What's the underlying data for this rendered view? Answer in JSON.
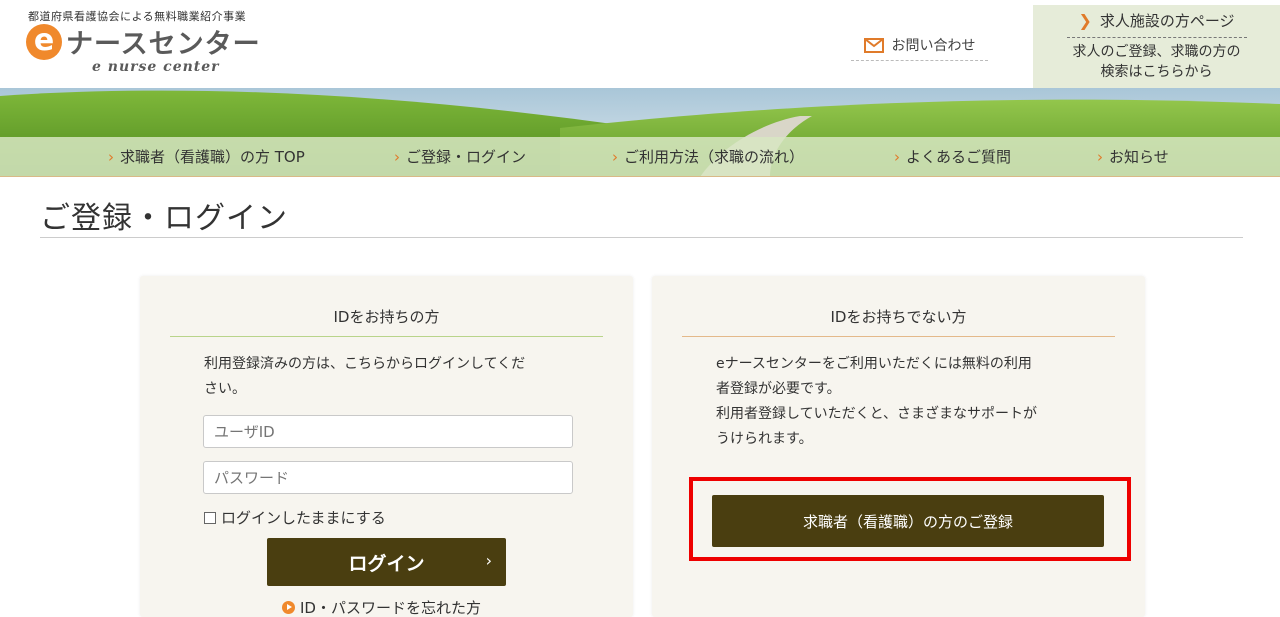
{
  "header": {
    "tagline": "都道府県看護協会による無料職業紹介事業",
    "logo_e": "e",
    "logo_text": "ナースセンター",
    "logo_sub": "e nurse center",
    "contact_label": "お問い合わせ",
    "contact_icon": "mail-icon",
    "facility": {
      "title": "求人施設の方ページ",
      "desc_line1": "求人のご登録、求職の方の",
      "desc_line2": "検索はこちらから"
    }
  },
  "nav": {
    "items": [
      {
        "label": "求職者（看護職）の方 TOP"
      },
      {
        "label": "ご登録・ログイン"
      },
      {
        "label": "ご利用方法（求職の流れ）"
      },
      {
        "label": "よくあるご質問"
      },
      {
        "label": "お知らせ"
      }
    ]
  },
  "main": {
    "page_title": "ご登録・ログイン",
    "login_panel": {
      "heading": "IDをお持ちの方",
      "desc_line1": "利用登録済みの方は、こちらからログインしてくだ",
      "desc_line2": "さい。",
      "user_placeholder": "ユーザID",
      "password_placeholder": "パスワード",
      "remember_label": "ログインしたままにする",
      "login_button": "ログイン",
      "login_arrow": "›",
      "forgot_link": "ID・パスワードを忘れた方"
    },
    "register_panel": {
      "heading": "IDをお持ちでない方",
      "desc_line1": "eナースセンターをご利用いただくには無料の利用",
      "desc_line2": "者登録が必要です。",
      "desc_line3": "利用者登録していただくと、さまざまなサポートが",
      "desc_line4": "うけられます。",
      "register_button": "求職者（看護職）の方のご登録"
    }
  },
  "colors": {
    "accent_orange": "#f0892c",
    "button_brown": "#4a3e10",
    "facility_bg": "#e6ecd9",
    "highlight_red": "#ee0000"
  }
}
